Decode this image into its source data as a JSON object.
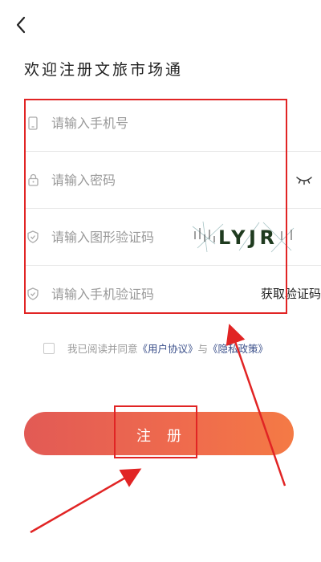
{
  "header": {
    "back_icon": "chevron-left-icon",
    "title": "欢迎注册文旅市场通"
  },
  "form": {
    "phone": {
      "placeholder": "请输入手机号",
      "icon": "phone-icon"
    },
    "password": {
      "placeholder": "请输入密码",
      "icon": "lock-icon",
      "toggle_icon": "eye-closed-icon"
    },
    "captcha": {
      "placeholder": "请输入图形验证码",
      "icon": "shield-icon",
      "image_text": "LYJR"
    },
    "sms": {
      "placeholder": "请输入手机验证码",
      "icon": "shield-icon",
      "get_code_label": "获取验证码"
    }
  },
  "agreement": {
    "prefix": "我已阅读并同意",
    "user_link": "《用户协议》",
    "conjunction": "与",
    "privacy_link": "《隐私政策》",
    "checked": false
  },
  "register_button": {
    "label": "注册"
  },
  "colors": {
    "accent_gradient_start": "#e25a55",
    "accent_gradient_end": "#f47a45",
    "annotation_red": "#e12424",
    "link": "#3a4f8a"
  }
}
